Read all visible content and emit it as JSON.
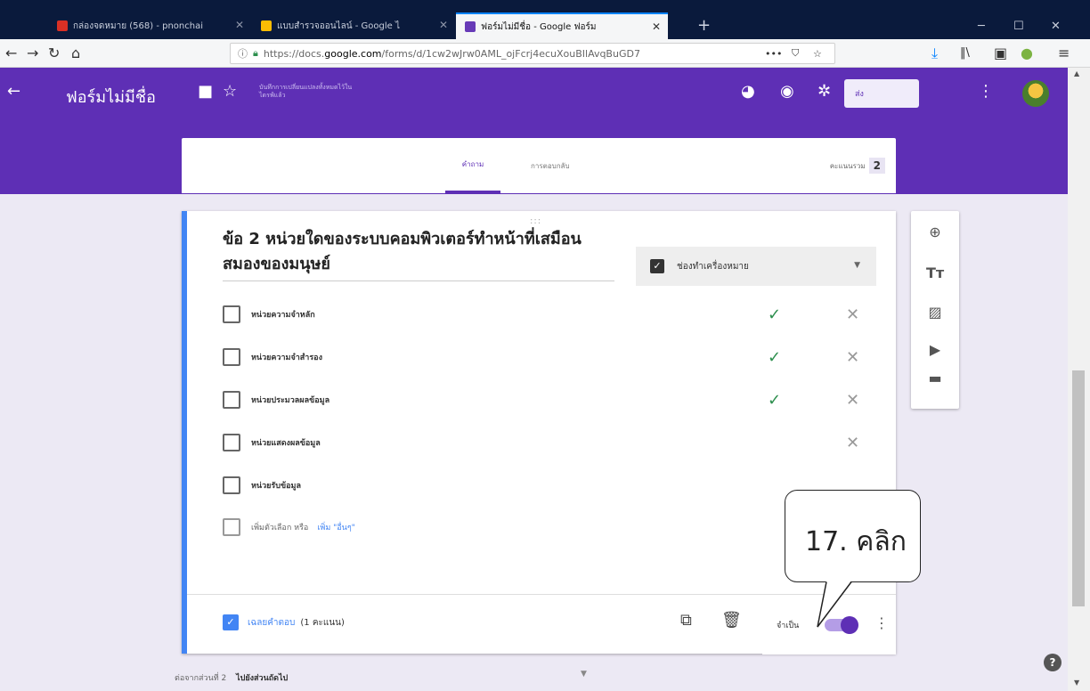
{
  "browser": {
    "tabs": [
      {
        "title": "กล่องจดหมาย (568) - pnonchai",
        "favicon_color": "#d93025"
      },
      {
        "title": "แบบสำรวจออนไลน์ - Google ไ",
        "favicon_color": "#fbbc04"
      },
      {
        "title": "ฟอร์มไม่มีชื่อ - Google ฟอร์ม",
        "favicon_color": "#673ab7",
        "active": true
      }
    ],
    "new_tab": "+",
    "url_prefix": "https://docs.",
    "url_domain": "google.com",
    "url_rest": "/forms/d/1cw2wJrw0AML_ojFcrj4ecuXouBIlAvqBuGD7",
    "url_more": "•••"
  },
  "header": {
    "back": "←",
    "title": "ฟอร์มไม่มีชื่อ",
    "saved_note": "บันทึกการเปลี่ยนแปลงทั้งหมดไว้ในไดรฟ์แล้ว",
    "send_label": "ส่ง",
    "more": "⋮"
  },
  "form_tabs": {
    "questions": "คำถาม",
    "responses": "การตอบกลับ",
    "total_points_label": "คะแนนรวม",
    "total_points": "2"
  },
  "question": {
    "drag_handle": ":::",
    "title": "ข้อ 2 หน่วยใดของระบบคอมพิวเตอร์ทำหน้าที่เสมือน สมองของมนุษย์",
    "type_label": "ช่องทำเครื่องหมาย",
    "options": [
      {
        "label": "หน่วยความจำหลัก",
        "correct": true
      },
      {
        "label": "หน่วยความจำสำรอง",
        "correct": true
      },
      {
        "label": "หน่วยประมวลผลข้อมูล",
        "correct": true
      },
      {
        "label": "หน่วยแสดงผลข้อมูล",
        "correct": false
      },
      {
        "label": "หน่วยรับข้อมูล",
        "correct": false
      }
    ],
    "add_option": "เพิ่มตัวเลือก หรือ",
    "add_other": "เพิ่ม \"อื่นๆ\"",
    "answer_key": "เฉลยคำตอบ",
    "points": "(1 คะแนน)",
    "required_label": "จำเป็น",
    "required": true
  },
  "footer": {
    "after_section": "ต่อจากส่วนที่ 2",
    "go_to": "ไปยังส่วนถัดไป"
  },
  "callout": {
    "text": "17. คลิก"
  },
  "colors": {
    "brand": "#5e2fb5",
    "accent_blue": "#4285f4",
    "correct_green": "#2d8f4e"
  }
}
